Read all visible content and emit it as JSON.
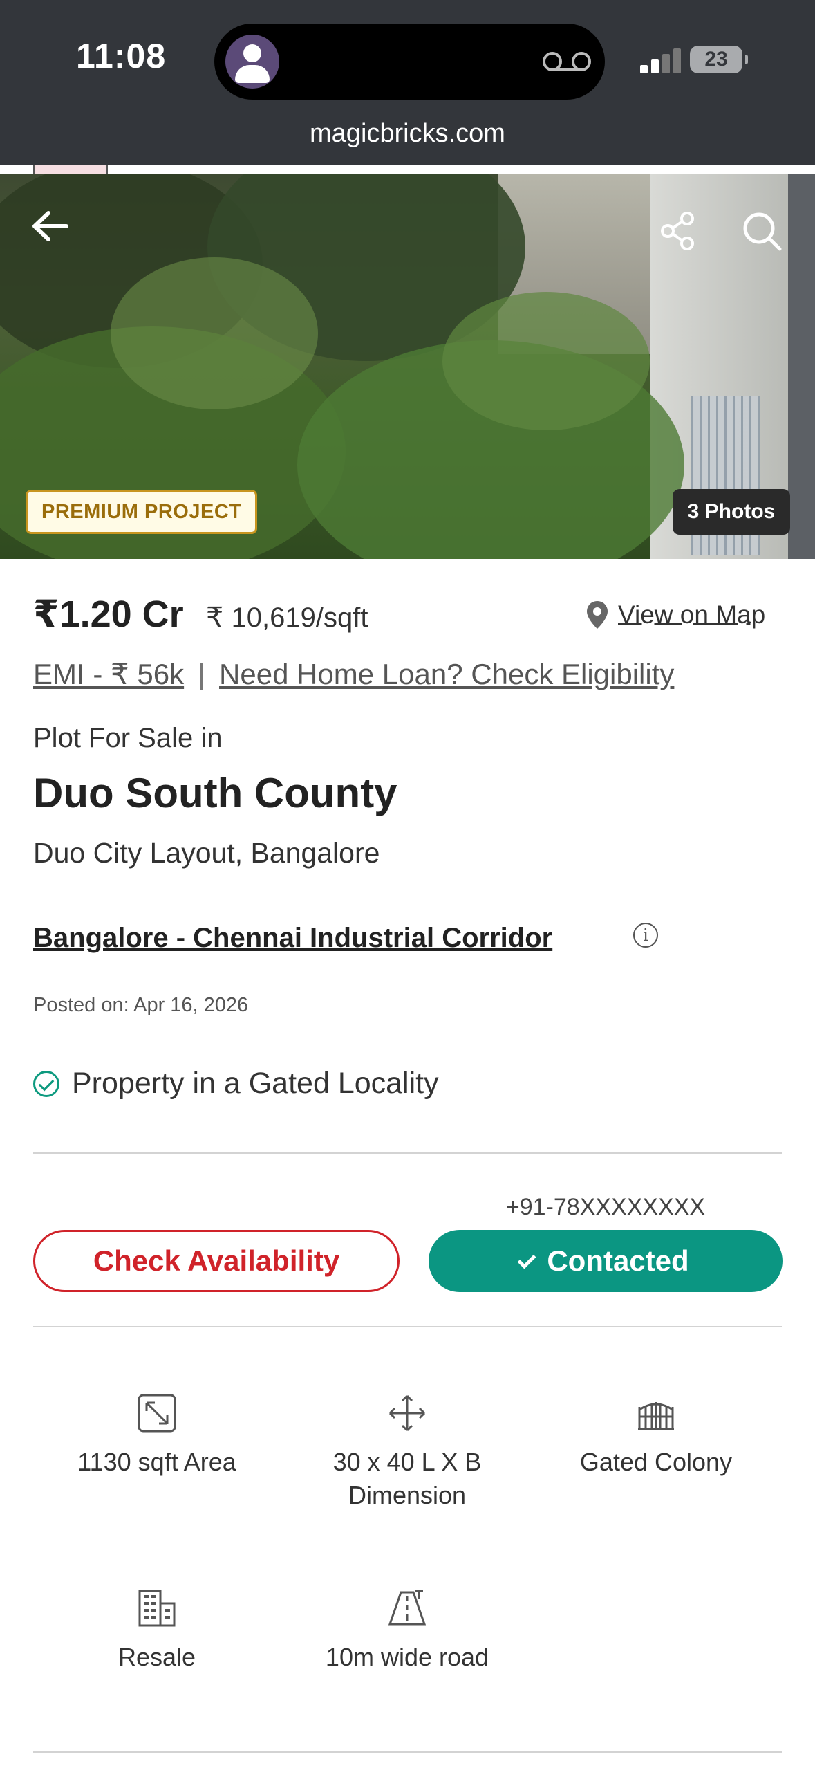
{
  "status_bar": {
    "time": "11:08",
    "battery": "23"
  },
  "browser": {
    "url": "magicbricks.com"
  },
  "hero": {
    "badge": "PREMIUM PROJECT",
    "photos_count": "3 Photos"
  },
  "price": {
    "total": "₹1.20 Cr",
    "per_sqft": "₹ 10,619/sqft",
    "view_on_map": "View on Map",
    "emi": "EMI - ₹ 56k",
    "separator": "|",
    "home_loan": "Need Home Loan? Check Eligibility"
  },
  "property": {
    "type_line": "Plot For Sale in",
    "name": "Duo South County",
    "location": "Duo City Layout, Bangalore",
    "corridor": "Bangalore - Chennai Industrial Corridor",
    "info_icon": "i",
    "posted": "Posted on: Apr 16, 2026",
    "gated": "Property in a Gated Locality"
  },
  "contact": {
    "phone": "+91-78XXXXXXXX",
    "check_availability": "Check Availability",
    "contacted": "Contacted"
  },
  "features": [
    {
      "icon": "area-icon",
      "label": "1130 sqft Area"
    },
    {
      "icon": "dimension-icon",
      "label": "30 x 40 L X B Dimension"
    },
    {
      "icon": "gate-icon",
      "label": "Gated Colony"
    },
    {
      "icon": "building-icon",
      "label": "Resale"
    },
    {
      "icon": "road-icon",
      "label": "10m wide road"
    }
  ],
  "colors": {
    "accent_red": "#d0232a",
    "accent_teal": "#0b9682",
    "badge_gold": "#c8951f",
    "topbar": "#33363b"
  }
}
